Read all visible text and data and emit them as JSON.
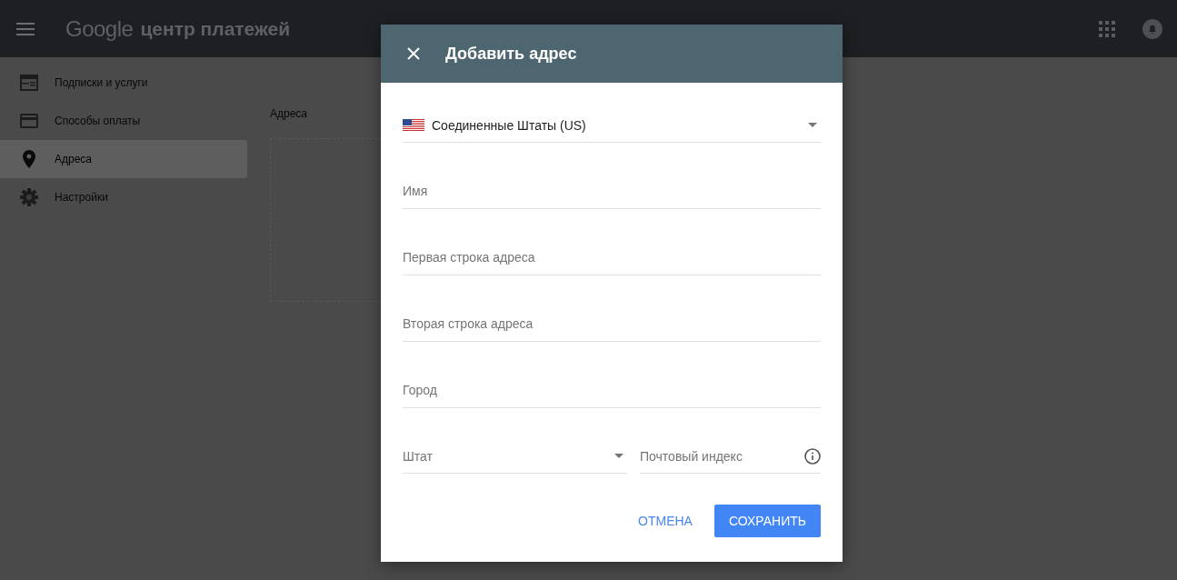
{
  "header": {
    "logo": "Google",
    "title": "центр платежей"
  },
  "sidebar": {
    "items": [
      {
        "label": "Подписки и услуги",
        "kind": "subscriptions",
        "selected": false
      },
      {
        "label": "Способы оплаты",
        "kind": "card",
        "selected": false
      },
      {
        "label": "Адреса",
        "kind": "pin",
        "selected": true
      },
      {
        "label": "Настройки",
        "kind": "gear",
        "selected": false
      }
    ]
  },
  "main": {
    "heading": "Адреса"
  },
  "dialog": {
    "title": "Добавить адрес",
    "country": {
      "value": "Соединенные Штаты (US)"
    },
    "fields": [
      {
        "placeholder": "Имя"
      },
      {
        "placeholder": "Первая строка адреса"
      },
      {
        "placeholder": "Вторая строка адреса"
      },
      {
        "placeholder": "Город"
      }
    ],
    "state": {
      "placeholder": "Штат"
    },
    "zip": {
      "placeholder": "Почтовый индекс"
    },
    "buttons": {
      "cancel": "ОТМЕНА",
      "save": "СОХРАНИТЬ"
    }
  }
}
